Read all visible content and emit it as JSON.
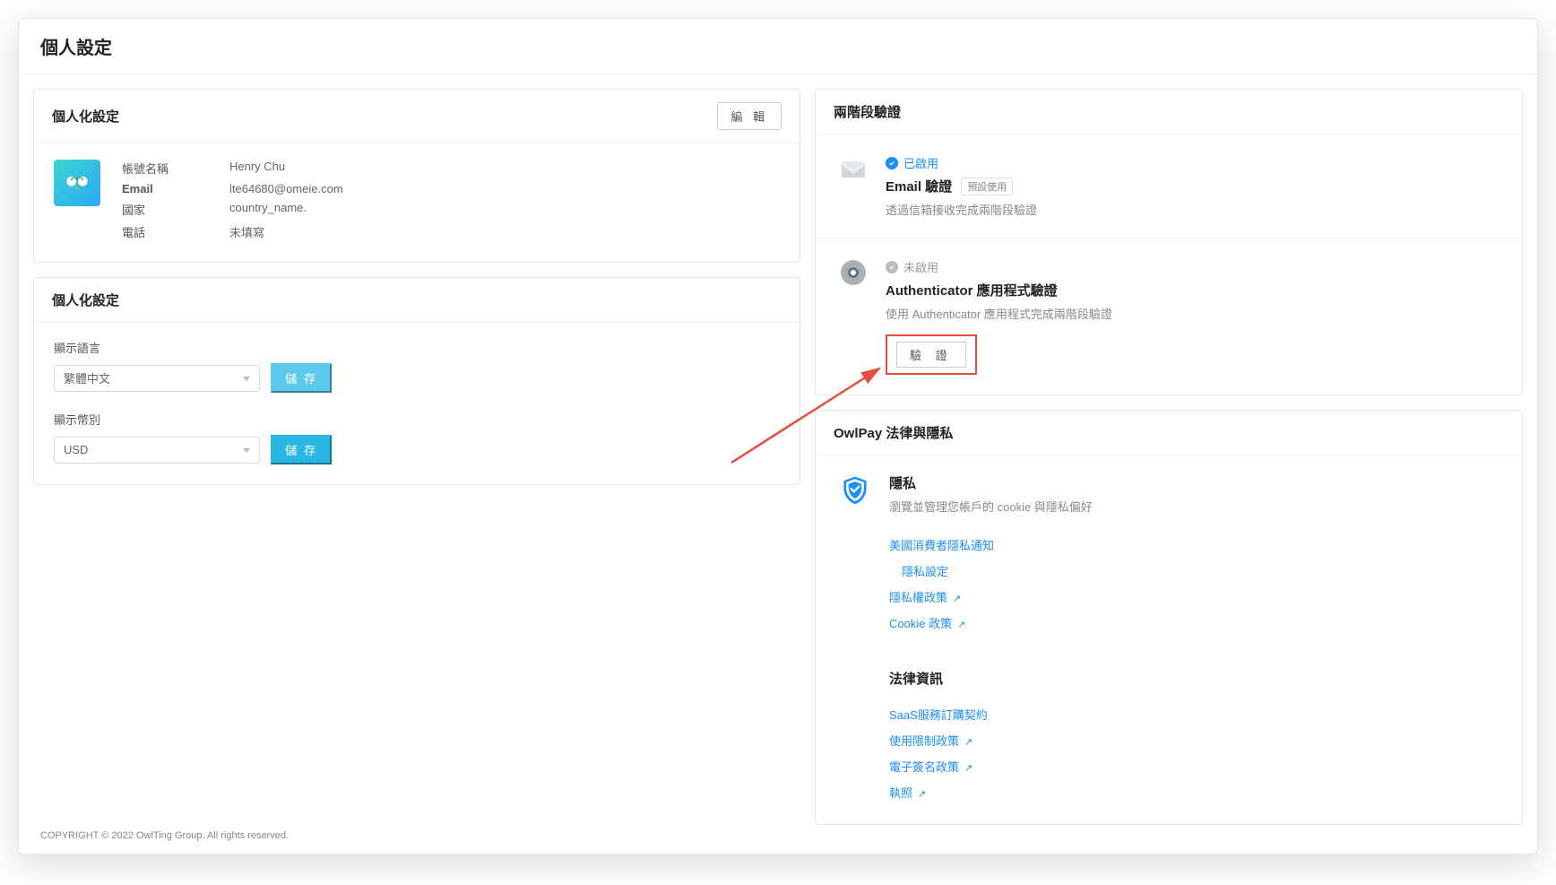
{
  "page": {
    "title": "個人設定"
  },
  "personal": {
    "card_title": "個人化設定",
    "edit_label": "編 輯",
    "fields": {
      "account_name": {
        "label": "帳號名稱",
        "value": "Henry Chu"
      },
      "email": {
        "label": "Email",
        "value": "lte64680@omeie.com"
      },
      "country": {
        "label": "國家",
        "value": "country_name."
      },
      "phone": {
        "label": "電話",
        "value": "未填寫"
      }
    }
  },
  "display": {
    "card_title": "個人化設定",
    "language_label": "顯示語言",
    "language_value": "繁體中文",
    "language_save": "儲 存",
    "currency_label": "顯示幣別",
    "currency_value": "USD",
    "currency_save": "儲 存"
  },
  "twofa": {
    "card_title": "兩階段驗證",
    "email": {
      "status": "已啟用",
      "title": "Email 驗證",
      "badge": "預設使用",
      "desc": "透過信箱接收完成兩階段驗證"
    },
    "authenticator": {
      "status": "未啟用",
      "title": "Authenticator 應用程式驗證",
      "desc": "使用 Authenticator 應用程式完成兩階段驗證",
      "verify_label": "驗 證"
    }
  },
  "legal": {
    "card_title": "OwlPay 法律與隱私",
    "privacy_title": "隱私",
    "privacy_desc": "瀏覽並管理您帳戶的 cookie 與隱私偏好",
    "links": {
      "ccpa": "美國消費者隱私通知",
      "settings": "隱私設定",
      "policy": "隱私權政策",
      "cookie": "Cookie 政策"
    },
    "legal_title": "法律資訊",
    "legal_links": {
      "saas": "SaaS服務訂購契約",
      "usage": "使用限制政策",
      "esign": "電子簽名政策",
      "license": "執照"
    }
  },
  "footer": "COPYRIGHT © 2022 OwlTing Group. All rights reserved."
}
